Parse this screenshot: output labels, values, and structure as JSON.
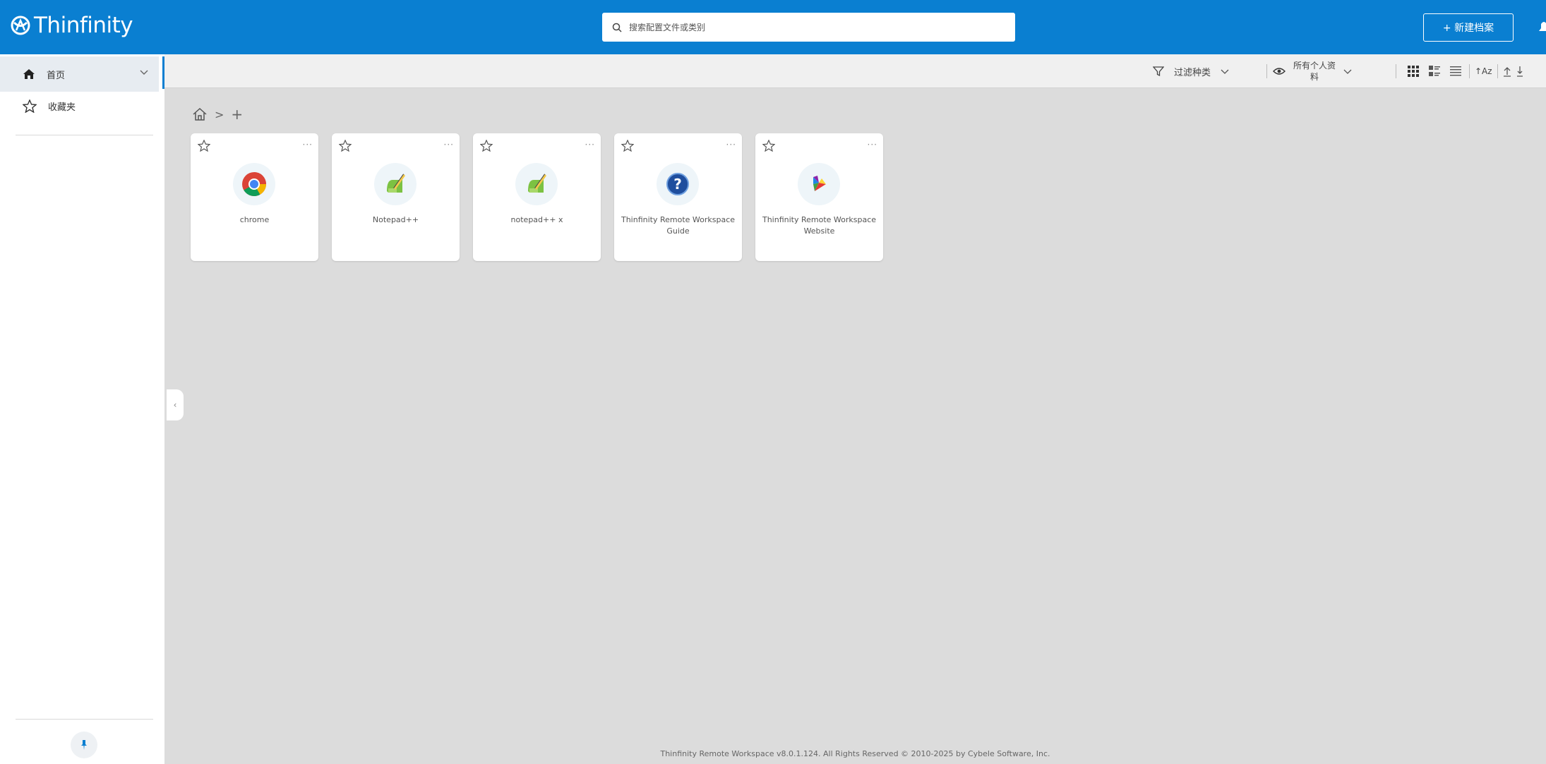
{
  "header": {
    "logo_text": "Thinfinity",
    "search_placeholder": "搜索配置文件或类别",
    "new_profile_label": "+ 新建档案"
  },
  "sidebar": {
    "items": [
      {
        "label": "首页",
        "icon": "home-icon",
        "active": true
      },
      {
        "label": "收藏夹",
        "icon": "star-icon",
        "active": false
      }
    ]
  },
  "toolbar": {
    "filter_label": "过滤种类",
    "profiles_label": "所有个人资料",
    "sort_label": "↑Az"
  },
  "breadcrumb": {
    "separator": ">",
    "add": "+"
  },
  "cards": [
    {
      "label": "chrome",
      "icon": "chrome-icon"
    },
    {
      "label": "Notepad++",
      "icon": "notepad-icon"
    },
    {
      "label": "notepad++ x",
      "icon": "notepad-icon"
    },
    {
      "label": "Thinfinity Remote Workspace Guide",
      "icon": "help-icon"
    },
    {
      "label": "Thinfinity Remote Workspace Website",
      "icon": "thinfinity-logo-icon"
    }
  ],
  "card_more": "···",
  "footer": {
    "text": "Thinfinity Remote Workspace v8.0.1.124. All Rights Reserved © 2010-2025 by Cybele Software, Inc."
  },
  "colors": {
    "brand_blue": "#0a7fd1",
    "main_bg": "#dcdcdc"
  }
}
